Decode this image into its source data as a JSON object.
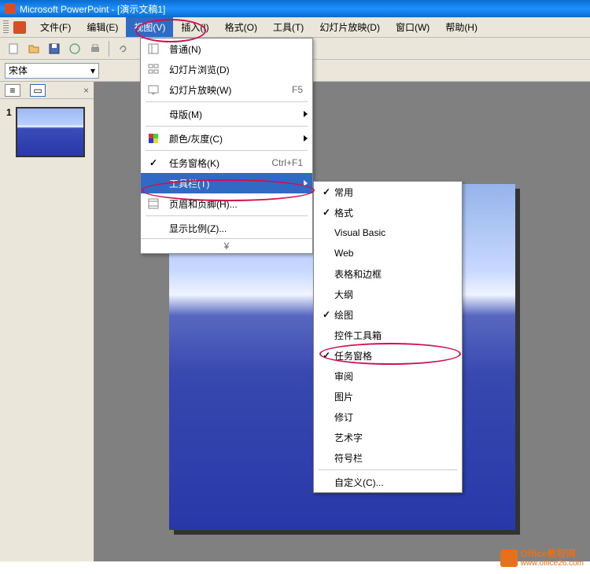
{
  "title": "Microsoft PowerPoint - [演示文稿1]",
  "menubar": {
    "file": "文件(F)",
    "edit": "编辑(E)",
    "view": "视图(V)",
    "insert": "插入(I)",
    "format": "格式(O)",
    "tools": "工具(T)",
    "slideshow": "幻灯片放映(D)",
    "window": "窗口(W)",
    "help": "帮助(H)"
  },
  "font": {
    "name": "宋体"
  },
  "viewMenu": {
    "normal": "普通(N)",
    "slideSorter": "幻灯片浏览(D)",
    "slideShow": "幻灯片放映(W)",
    "slideShowKey": "F5",
    "master": "母版(M)",
    "colorGray": "颜色/灰度(C)",
    "taskPane": "任务窗格(K)",
    "taskPaneKey": "Ctrl+F1",
    "toolbars": "工具栏(T)",
    "headerFooter": "页眉和页脚(H)...",
    "zoom": "显示比例(Z)...",
    "expand": "¥"
  },
  "toolbarsMenu": {
    "common": "常用",
    "format": "格式",
    "vb": "Visual Basic",
    "web": "Web",
    "tableBorder": "表格和边框",
    "outline": "大纲",
    "drawing": "绘图",
    "controlToolbox": "控件工具箱",
    "taskPane": "任务窗格",
    "review": "审阅",
    "picture": "图片",
    "revision": "修订",
    "wordart": "艺术字",
    "symbols": "符号栏",
    "customize": "自定义(C)..."
  },
  "thumbs": {
    "slide1_num": "1"
  },
  "watermark": {
    "line1": "Office教程网",
    "line2": "www.office26.com"
  }
}
